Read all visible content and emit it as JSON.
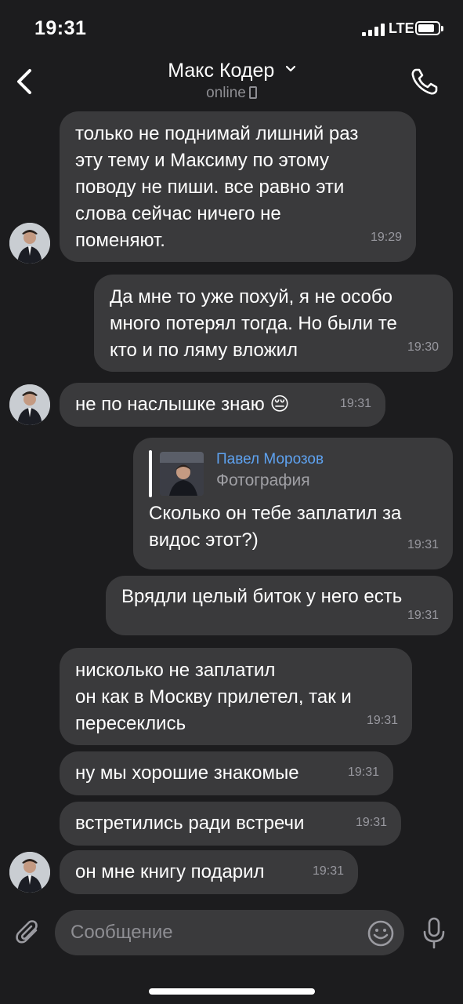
{
  "status": {
    "time": "19:31",
    "network": "LTE",
    "signal_bars": 4,
    "battery_level": 0.75
  },
  "header": {
    "back_icon": "chevron-left-icon",
    "contact_name": "Макс Кодер",
    "presence": "online",
    "call_icon": "phone-icon"
  },
  "messages": [
    {
      "side": "in",
      "text": "только не поднимай лишний раз\nэту тему и Максиму по этому\nповоду не пиши. все равно эти\nслова сейчас ничего не\nпоменяют.",
      "time": "19:29"
    },
    {
      "side": "out",
      "text": "Да мне то уже похуй, я не особо\nмного потерял тогда. Но были те\nкто и по ляму вложил",
      "time": "19:30"
    },
    {
      "side": "in",
      "text": "не по наслышке знаю 😔",
      "time": "19:31"
    },
    {
      "side": "out",
      "reply_author": "Павел Морозов",
      "reply_kind": "Фотография",
      "text": "Сколько он тебе заплатил за\nвидос этот?)",
      "time": "19:31"
    },
    {
      "side": "out",
      "text": "Врядли целый биток у него есть",
      "time": "19:31"
    },
    {
      "side": "in",
      "text": "нисколько не заплатил\nон как в Москву прилетел, так и\nпересеклись",
      "time": "19:31"
    },
    {
      "side": "in",
      "text": "ну мы хорошие знакомые",
      "time": "19:31"
    },
    {
      "side": "in",
      "text": "встретились ради встречи",
      "time": "19:31"
    },
    {
      "side": "in",
      "text": "он мне книгу подарил",
      "time": "19:31"
    }
  ],
  "composer": {
    "placeholder": "Сообщение",
    "attach_icon": "paperclip-icon",
    "emoji_icon": "emoji-icon",
    "mic_icon": "microphone-icon"
  },
  "colors": {
    "background": "#1c1c1e",
    "bubble": "#3a3a3c",
    "reply_author": "#5ea2f0",
    "muted_text": "#8e8e93"
  }
}
